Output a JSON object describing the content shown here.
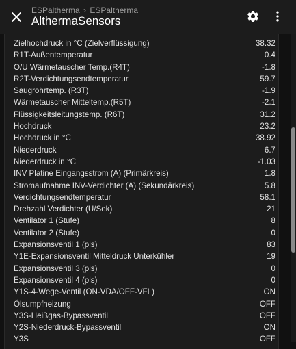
{
  "header": {
    "breadcrumb": [
      "ESPaltherma",
      "ESPaltherma"
    ],
    "breadcrumb_separator": "›",
    "title": "AlthermaSensors"
  },
  "icons": {
    "close": "close-icon",
    "settings": "gear-icon",
    "menu": "dots-vertical-icon"
  },
  "colors": {
    "background": "#111111",
    "header": "#1c1c1c",
    "card": "#1c1c1c",
    "text": "#e1e1e1",
    "secondary_text": "#9b9b9b"
  },
  "sensors": [
    {
      "label": "Zielhochdruck in °C (Zielverflüssigung)",
      "value": "38.32"
    },
    {
      "label": "R1T-Außentemperatur",
      "value": "0.4"
    },
    {
      "label": "O/U Wärmetauscher Temp.(R4T)",
      "value": "-1.8"
    },
    {
      "label": "R2T-Verdichtungsendtemperatur",
      "value": "59.7"
    },
    {
      "label": "Saugrohrtemp. (R3T)",
      "value": "-1.9"
    },
    {
      "label": "Wärmetauscher Mitteltemp.(R5T)",
      "value": "-2.1"
    },
    {
      "label": "Flüssigkeitsleitungstemp. (R6T)",
      "value": "31.2"
    },
    {
      "label": "Hochdruck",
      "value": "23.2"
    },
    {
      "label": "Hochdruck in °C",
      "value": "38.92"
    },
    {
      "label": "Niederdruck",
      "value": "6.7"
    },
    {
      "label": "Niederdruck in °C",
      "value": "-1.03"
    },
    {
      "label": "INV Platine Eingangsstrom (A) (Primärkreis)",
      "value": "1.8"
    },
    {
      "label": "Stromaufnahme INV-Verdichter (A) (Sekundärkreis)",
      "value": "5.8"
    },
    {
      "label": "Verdichtungsendtemperatur",
      "value": "58.1"
    },
    {
      "label": "Drehzahl Verdichter (U/Sek)",
      "value": "21"
    },
    {
      "label": "Ventilator 1 (Stufe)",
      "value": "8"
    },
    {
      "label": "Ventilator 2 (Stufe)",
      "value": "0"
    },
    {
      "label": "Expansionsventil 1 (pls)",
      "value": "83"
    },
    {
      "label": "Y1E-Expansionsventil Mitteldruck Unterkühler",
      "value": "19"
    },
    {
      "label": "Expansionsventil 3 (pls)",
      "value": "0"
    },
    {
      "label": "Expansionsventil 4 (pls)",
      "value": "0"
    },
    {
      "label": "Y1S-4-Wege-Ventil (ON-VDA/OFF-VFL)",
      "value": "ON"
    },
    {
      "label": "Ölsumpfheizung",
      "value": "OFF"
    },
    {
      "label": "Y3S-Heißgas-Bypassventil",
      "value": "OFF"
    },
    {
      "label": "Y2S-Niederdruck-Bypassventil",
      "value": "ON"
    },
    {
      "label": "Y3S",
      "value": "OFF"
    }
  ]
}
